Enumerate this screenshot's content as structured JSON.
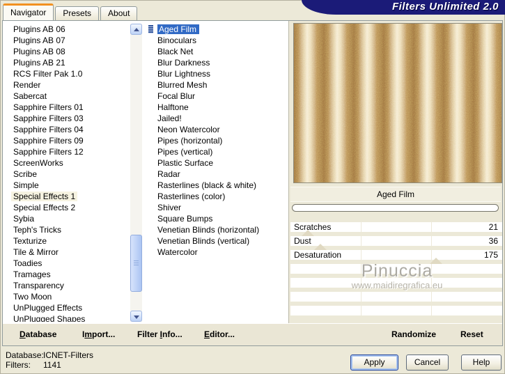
{
  "window": {
    "title": "Filters Unlimited 2.0"
  },
  "tabs": [
    {
      "label": "Navigator",
      "active": true
    },
    {
      "label": "Presets",
      "active": false
    },
    {
      "label": "About",
      "active": false
    }
  ],
  "category_list": {
    "selected": "Special Effects 1",
    "items": [
      "Plugins AB 06",
      "Plugins AB 07",
      "Plugins AB 08",
      "Plugins AB 21",
      "RCS Filter Pak 1.0",
      "Render",
      "Sabercat",
      "Sapphire Filters 01",
      "Sapphire Filters 03",
      "Sapphire Filters 04",
      "Sapphire Filters 09",
      "Sapphire Filters 12",
      "ScreenWorks",
      "Scribe",
      "Simple",
      "Special Effects 1",
      "Special Effects 2",
      "Sybia",
      "Teph's Tricks",
      "Texturize",
      "Tile & Mirror",
      "Toadies",
      "Tramages",
      "Transparency",
      "Two Moon",
      "UnPlugged Effects",
      "UnPlugged Shapes"
    ]
  },
  "filter_list": {
    "selected": "Aged Film",
    "items": [
      "Aged Film",
      "Binoculars",
      "Black Net",
      "Blur Darkness",
      "Blur Lightness",
      "Blurred Mesh",
      "Focal Blur",
      "Halftone",
      "Jailed!",
      "Neon Watercolor",
      "Pipes (horizontal)",
      "Pipes (vertical)",
      "Plastic Surface",
      "Radar",
      "Rasterlines (black & white)",
      "Rasterlines (color)",
      "Shiver",
      "Square Bumps",
      "Venetian Blinds (horizontal)",
      "Venetian Blinds (vertical)",
      "Watercolor"
    ]
  },
  "preview": {
    "caption": "Aged Film",
    "progress_percent": 0
  },
  "sliders": {
    "max": 255,
    "rows": [
      {
        "label": "Scratches",
        "value": 21
      },
      {
        "label": "Dust",
        "value": 36
      },
      {
        "label": "Desaturation",
        "value": 175
      }
    ],
    "empty_rows": 4
  },
  "watermark": {
    "name": "Pinuccia",
    "site": "www.maidiregrafica.eu"
  },
  "toolbar": {
    "left": [
      {
        "label": "Database",
        "accel": 0
      },
      {
        "label": "Import...",
        "accel": 1
      },
      {
        "label": "Filter Info...",
        "accel": 7
      },
      {
        "label": "Editor...",
        "accel": 0
      }
    ],
    "randomize": "Randomize",
    "reset": "Reset"
  },
  "status": {
    "database_label": "Database:",
    "database_value": "ICNET-Filters",
    "filters_label": "Filters:",
    "filters_value": "1141"
  },
  "buttons": [
    {
      "label": "Apply",
      "focused": true
    },
    {
      "label": "Cancel",
      "focused": false
    },
    {
      "label": "Help",
      "focused": false
    }
  ],
  "colors": {
    "banner": "#1B1B78",
    "selection": "#316AC5",
    "dialog_bg": "#ECE9D8",
    "texture_dark": "#9E7340",
    "texture_light": "#F6ECD2"
  }
}
